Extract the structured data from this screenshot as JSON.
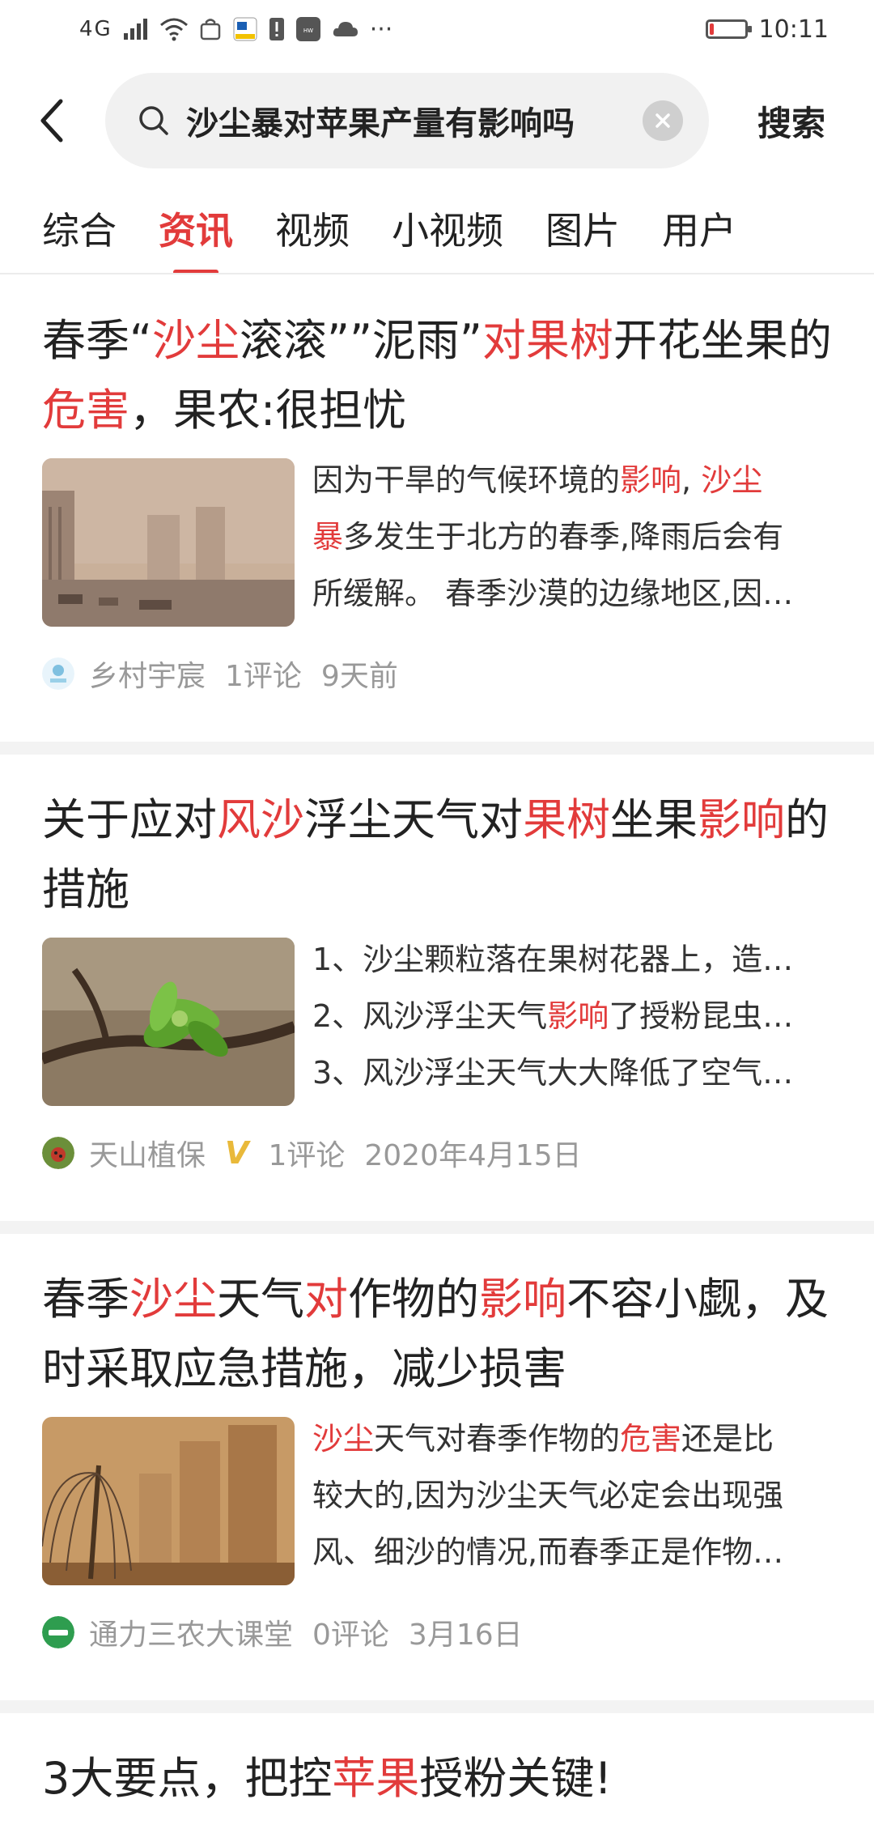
{
  "status_bar": {
    "network": "4G",
    "time": "10:11",
    "icons": [
      "signal-icon",
      "wifi-icon",
      "bag-icon",
      "app-icon",
      "alert-icon",
      "huawei-icon",
      "cloud-icon",
      "more-icon"
    ],
    "battery_level": 0.12,
    "battery_color": "#e23b3b"
  },
  "search": {
    "query": "沙尘暴对苹果产量有影响吗",
    "button_label": "搜索"
  },
  "tabs": [
    {
      "label": "综合",
      "active": false
    },
    {
      "label": "资讯",
      "active": true
    },
    {
      "label": "视频",
      "active": false
    },
    {
      "label": "小视频",
      "active": false
    },
    {
      "label": "图片",
      "active": false
    },
    {
      "label": "用户",
      "active": false
    }
  ],
  "accent_color": "#e23b3b",
  "articles": [
    {
      "title_parts": [
        {
          "text": "春季“",
          "hl": false
        },
        {
          "text": "沙尘",
          "hl": true
        },
        {
          "text": "滚滚””泥雨”",
          "hl": false
        },
        {
          "text": "对果树",
          "hl": true
        },
        {
          "text": "开花坐果的",
          "hl": false
        },
        {
          "text": "危害",
          "hl": true
        },
        {
          "text": "，果农:很担忧",
          "hl": false
        }
      ],
      "summary_lines": [
        [
          {
            "text": "因为干旱的气候环境的",
            "hl": false
          },
          {
            "text": "影响",
            "hl": true
          },
          {
            "text": ", ",
            "hl": false
          },
          {
            "text": "沙尘",
            "hl": true
          }
        ],
        [
          {
            "text": "暴",
            "hl": true
          },
          {
            "text": "多发生于北方的春季,降雨后会有",
            "hl": false
          }
        ],
        [
          {
            "text": "所缓解。 春季沙漠的边缘地区,因…",
            "hl": false
          }
        ]
      ],
      "author": "乡村宇宸",
      "comments": "1评论",
      "time": "9天前",
      "verified": false
    },
    {
      "title_parts": [
        {
          "text": "关于应对",
          "hl": false
        },
        {
          "text": "风沙",
          "hl": true
        },
        {
          "text": "浮尘天气对",
          "hl": false
        },
        {
          "text": "果树",
          "hl": true
        },
        {
          "text": "坐果",
          "hl": false
        },
        {
          "text": "影响",
          "hl": true
        },
        {
          "text": "的措施",
          "hl": false
        }
      ],
      "summary_lines": [
        [
          {
            "text": "1、沙尘颗粒落在果树花器上，造…",
            "hl": false
          }
        ],
        [
          {
            "text": "2、风沙浮尘天气",
            "hl": false
          },
          {
            "text": "影响",
            "hl": true
          },
          {
            "text": "了授粉昆虫…",
            "hl": false
          }
        ],
        [
          {
            "text": "3、风沙浮尘天气大大降低了空气…",
            "hl": false
          }
        ]
      ],
      "author": "天山植保",
      "comments": "1评论",
      "time": "2020年4月15日",
      "verified": true
    },
    {
      "title_parts": [
        {
          "text": "春季",
          "hl": false
        },
        {
          "text": "沙尘",
          "hl": true
        },
        {
          "text": "天气",
          "hl": false
        },
        {
          "text": "对",
          "hl": true
        },
        {
          "text": "作物的",
          "hl": false
        },
        {
          "text": "影响",
          "hl": true
        },
        {
          "text": "不容小觑，及时采取应急措施，减少损害",
          "hl": false
        }
      ],
      "summary_lines": [
        [
          {
            "text": "沙尘",
            "hl": true
          },
          {
            "text": "天气对春季作物的",
            "hl": false
          },
          {
            "text": "危害",
            "hl": true
          },
          {
            "text": "还是比",
            "hl": false
          }
        ],
        [
          {
            "text": "较大的,因为沙尘天气必定会出现强",
            "hl": false
          }
        ],
        [
          {
            "text": "风、细沙的情况,而春季正是作物…",
            "hl": false
          }
        ]
      ],
      "author": "通力三农大课堂",
      "comments": "0评论",
      "time": "3月16日",
      "verified": false
    }
  ],
  "partial_next": {
    "title_parts": [
      {
        "text": "3大要点，把控",
        "hl": false
      },
      {
        "text": "苹果",
        "hl": true
      },
      {
        "text": "授粉关键!",
        "hl": false
      }
    ]
  }
}
